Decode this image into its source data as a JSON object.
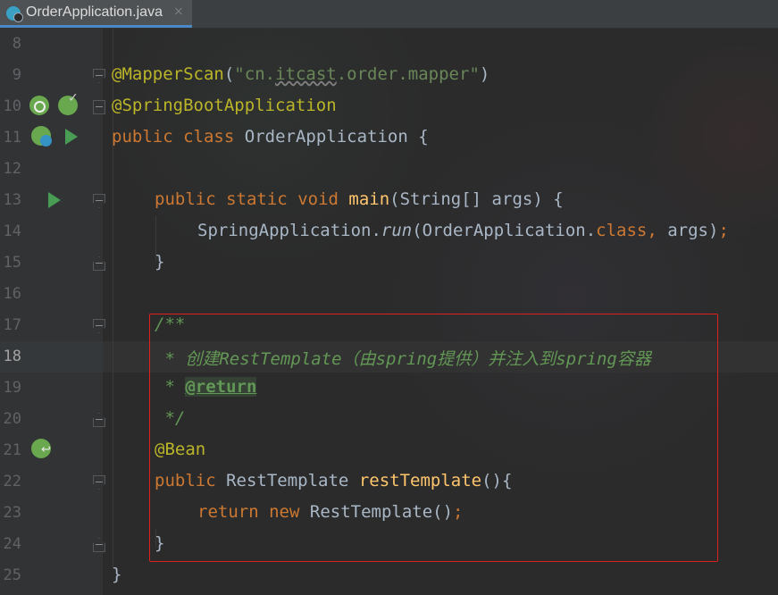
{
  "tab": {
    "file_name": "OrderApplication.java",
    "close": "×"
  },
  "lines": [
    {
      "n": "8"
    },
    {
      "n": "9",
      "annotation": "@MapperScan",
      "open": "(",
      "str_q1": "\"",
      "str_a": "cn.",
      "str_b": "itcast",
      "str_c": ".order.mapper",
      "str_q2": "\"",
      "close": ")"
    },
    {
      "n": "10",
      "annotation": "@SpringBootApplication"
    },
    {
      "n": "11",
      "kw1": "public",
      "kw2": "class",
      "name": "OrderApplication",
      "brace": "{"
    },
    {
      "n": "12"
    },
    {
      "n": "13",
      "kw1": "public",
      "kw2": "static",
      "kw3": "void",
      "method": "main",
      "params": "(String[] args)",
      "brace": "{"
    },
    {
      "n": "14",
      "cls": "SpringApplication.",
      "method": "run",
      "args_a": "(OrderApplication.",
      "kw": "class",
      "comma": ",",
      "args_b": " args)",
      "semi": ";"
    },
    {
      "n": "15",
      "brace": "}"
    },
    {
      "n": "16"
    },
    {
      "n": "17",
      "doc": "/**"
    },
    {
      "n": "18",
      "doc": " * 创建RestTemplate（由spring提供）并注入到spring容器"
    },
    {
      "n": "19",
      "doc": " * ",
      "tag": "@return"
    },
    {
      "n": "20",
      "doc": " */"
    },
    {
      "n": "21",
      "annotation": "@Bean"
    },
    {
      "n": "22",
      "kw1": "public",
      "type": "RestTemplate",
      "method": "restTemplate",
      "paren": "()",
      "brace": "{"
    },
    {
      "n": "23",
      "kw1": "return",
      "kw2": "new",
      "call": "RestTemplate()",
      "semi": ";"
    },
    {
      "n": "24",
      "brace": "}"
    },
    {
      "n": "25",
      "brace": "}"
    }
  ],
  "colors": {
    "keyword": "#cc7832",
    "annotation": "#bbb529",
    "string": "#6a8759",
    "method": "#ffc66d",
    "doc_comment": "#629755",
    "highlight_border": "#e02020"
  },
  "gutter_icons": [
    "spring-bean-search-icon",
    "spring-check-icon",
    "spring-boot-run-config-icon",
    "run-icon",
    "run-icon",
    "spring-bean-navigate-icon"
  ]
}
